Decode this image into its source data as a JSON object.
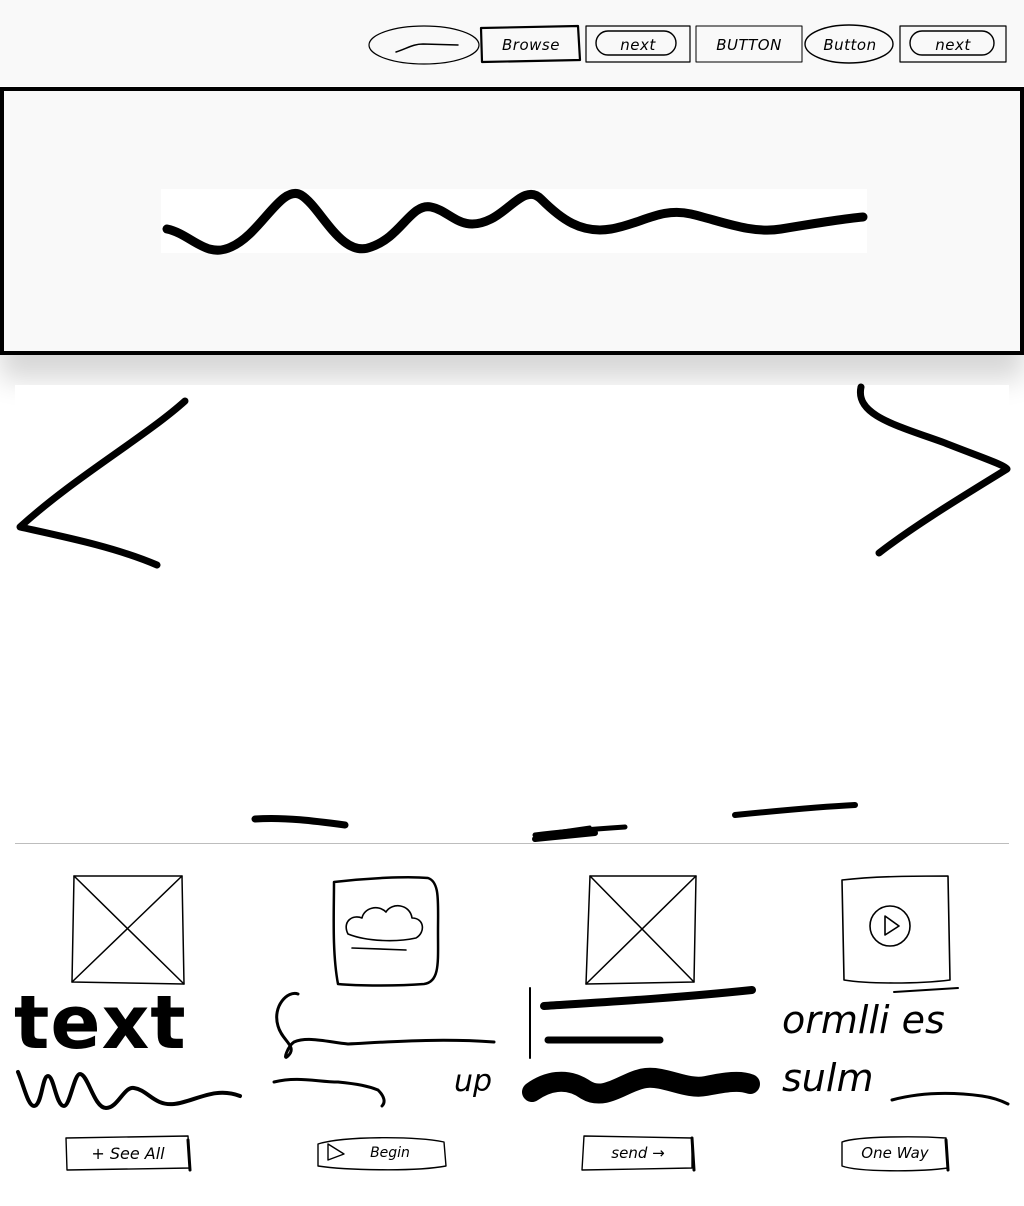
{
  "header": {
    "nav": [
      {
        "label": ""
      },
      {
        "label": "Browse"
      },
      {
        "label": "next"
      },
      {
        "label": "BUTTON"
      },
      {
        "label": "Button"
      },
      {
        "label": "next"
      }
    ]
  },
  "cards": [
    {
      "heading": "text",
      "button_label": "+ See All",
      "media_icon": "image-placeholder-icon"
    },
    {
      "heading": "",
      "trailing_word": "up",
      "button_label": "Begin",
      "button_icon": "play-triangle-icon",
      "media_icon": "cloud-icon"
    },
    {
      "heading": "",
      "button_label": "send →",
      "media_icon": "image-placeholder-icon"
    },
    {
      "heading": "",
      "line1": "ormlli es",
      "line2": "sulm",
      "button_label": "One Way",
      "media_icon": "play-icon"
    }
  ],
  "carousel": {
    "prev_icon": "chevron-left-icon",
    "next_icon": "chevron-right-icon"
  }
}
